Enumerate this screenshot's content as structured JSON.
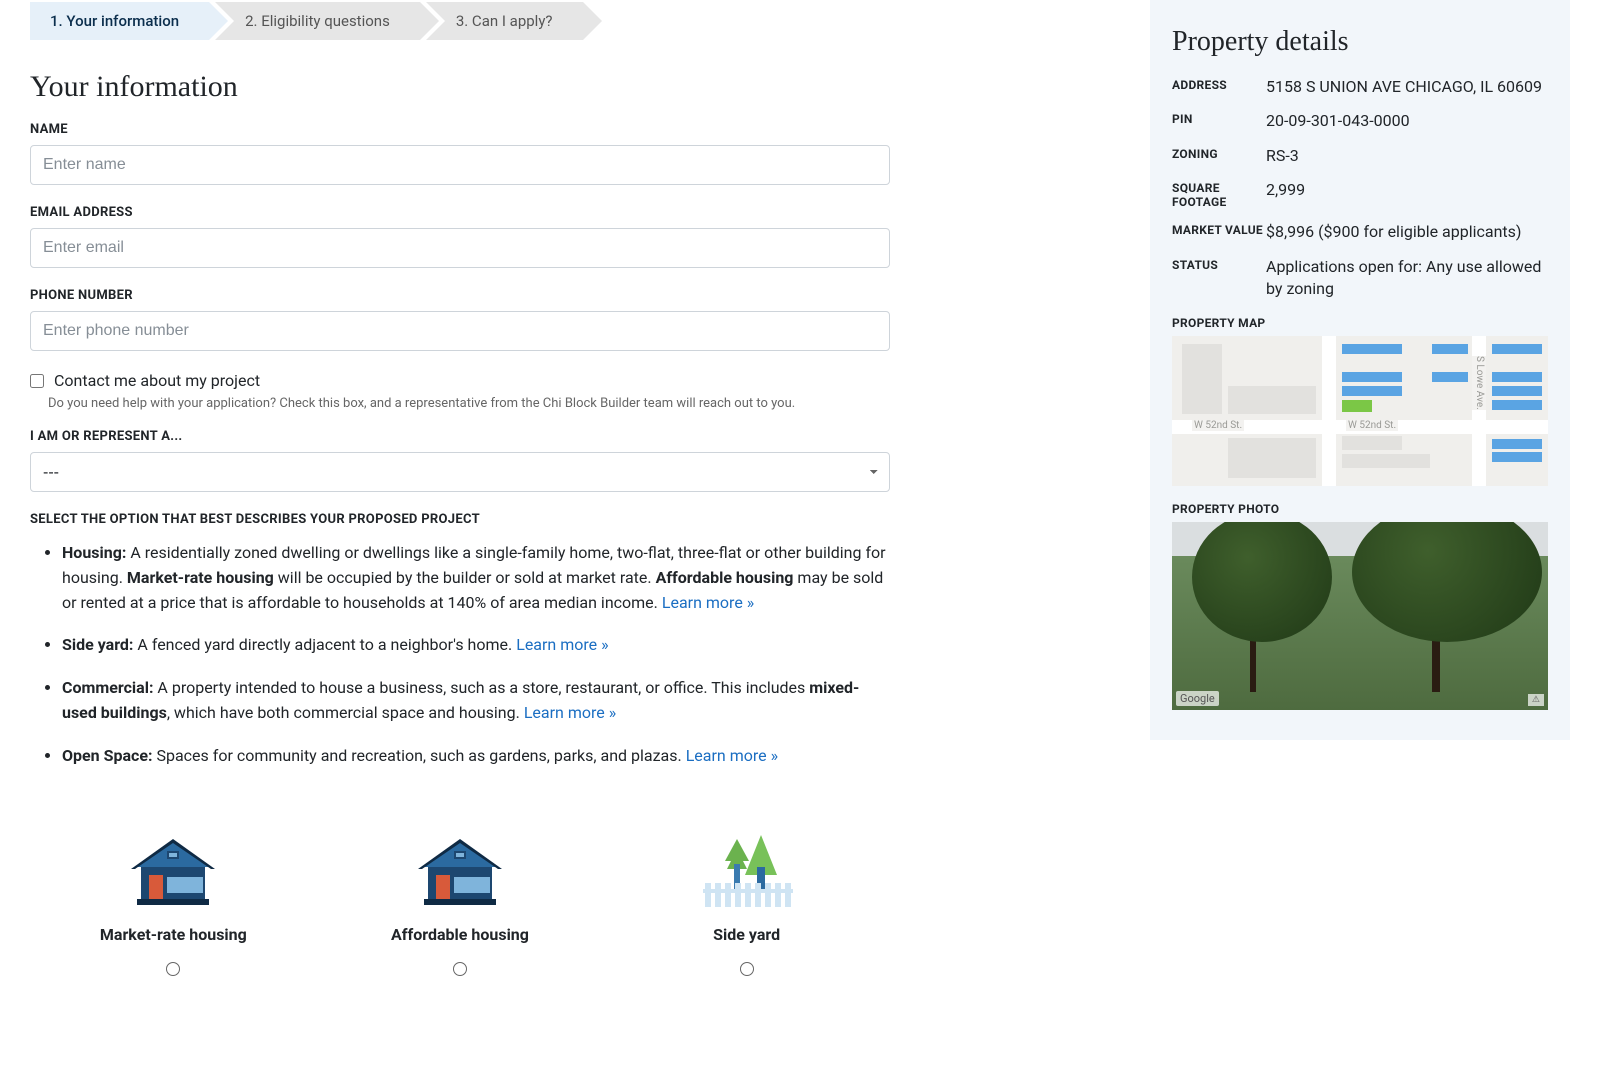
{
  "stepper": [
    {
      "label": "1. Your information"
    },
    {
      "label": "2. Eligibility questions"
    },
    {
      "label": "3. Can I apply?"
    }
  ],
  "page_title": "Your information",
  "fields": {
    "name": {
      "label": "NAME",
      "placeholder": "Enter name"
    },
    "email": {
      "label": "EMAIL ADDRESS",
      "placeholder": "Enter email"
    },
    "phone": {
      "label": "PHONE NUMBER",
      "placeholder": "Enter phone number"
    },
    "contact_checkbox": {
      "label": "Contact me about my project",
      "help": "Do you need help with your application? Check this box, and a representative from the Chi Block Builder team will reach out to you."
    },
    "represent": {
      "label": "I AM OR REPRESENT A...",
      "placeholder": "---"
    },
    "proposed": {
      "label": "SELECT THE OPTION THAT BEST DESCRIBES YOUR PROPOSED PROJECT"
    }
  },
  "option_desc": {
    "housing": {
      "term": "Housing:",
      "body1": " A residentially zoned dwelling or dwellings like a single-family home, two-flat, three-flat or other building for housing. ",
      "bold1": "Market-rate housing",
      "body2": " will be occupied by the builder or sold at market rate. ",
      "bold2": "Affordable housing",
      "body3": " may be sold or rented at a price that is affordable to households at 140% of area median income. ",
      "link": "Learn more »"
    },
    "sideyard": {
      "term": "Side yard:",
      "body": " A fenced yard directly adjacent to a neighbor's home. ",
      "link": "Learn more »"
    },
    "commercial": {
      "term": "Commercial:",
      "body1": " A property intended to house a business, such as a store, restaurant, or office. This includes ",
      "bold1": "mixed-used buildings",
      "body2": ", which have both commercial space and housing. ",
      "link": "Learn more »"
    },
    "openspace": {
      "term": "Open Space:",
      "body": " Spaces for community and recreation, such as gardens, parks, and plazas. ",
      "link": "Learn more »"
    }
  },
  "project_options": [
    {
      "name": "Market-rate housing"
    },
    {
      "name": "Affordable housing"
    },
    {
      "name": "Side yard"
    }
  ],
  "sidebar": {
    "title": "Property details",
    "address_label": "ADDRESS",
    "address": "5158 S UNION AVE CHICAGO, IL 60609",
    "pin_label": "PIN",
    "pin": "20-09-301-043-0000",
    "zoning_label": "ZONING",
    "zoning": "RS-3",
    "sqft_label": "SQUARE FOOTAGE",
    "sqft": "2,999",
    "mv_label": "MARKET VALUE",
    "mv": "$8,996 ($900 for eligible applicants)",
    "status_label": "STATUS",
    "status": "Applications open for: Any use allowed by zoning",
    "map_label": "PROPERTY MAP",
    "photo_label": "PROPERTY PHOTO",
    "map_streets": {
      "h": "W 52nd St.",
      "v": "S Lowe Ave."
    },
    "photo_watermark": "Google"
  }
}
